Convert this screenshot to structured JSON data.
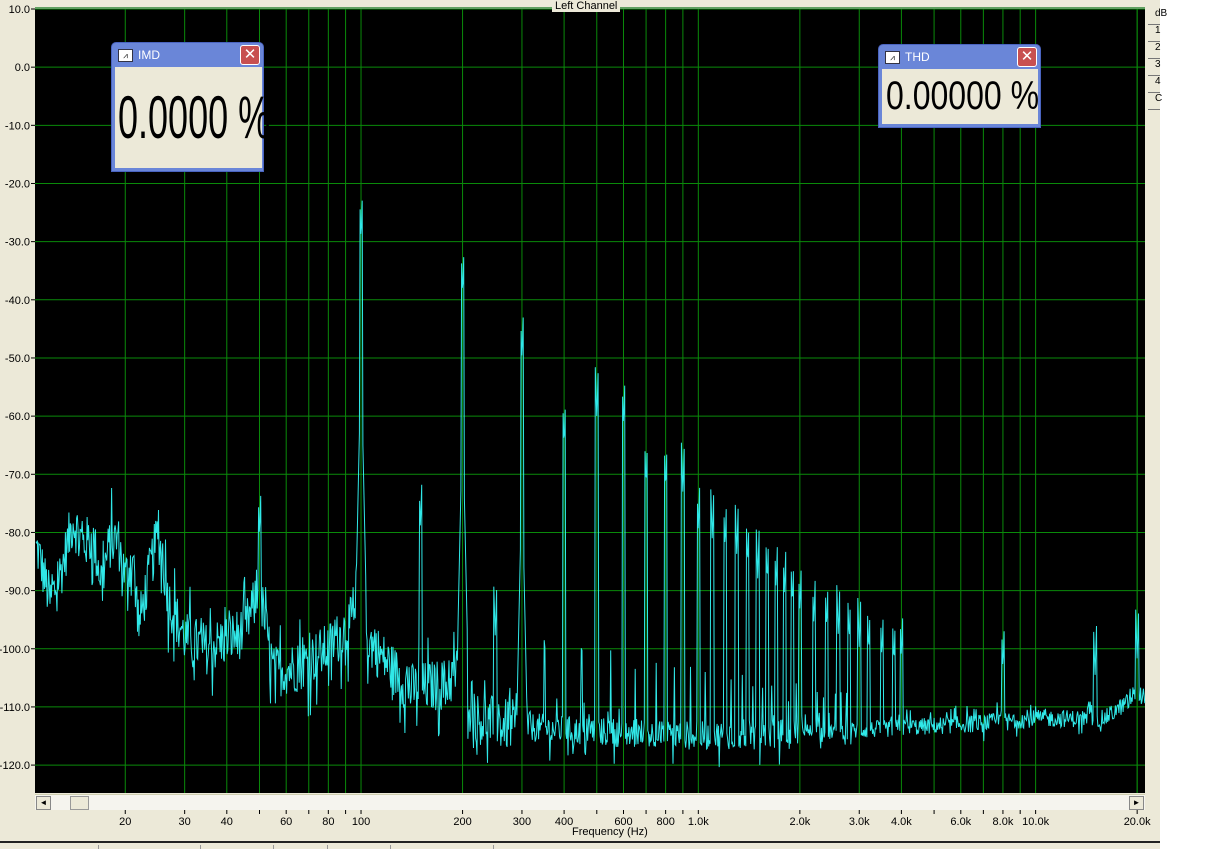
{
  "window": {
    "title": "Left Channel"
  },
  "side_buttons": [
    "dB",
    "1",
    "2",
    "3",
    "4",
    "C"
  ],
  "imd": {
    "title": "IMD",
    "value": "0.0000 %"
  },
  "thd": {
    "title": "THD",
    "value": "0.00000 %"
  },
  "scroll": {
    "left": "◄",
    "right": "►"
  },
  "chart_data": {
    "type": "line",
    "title": "Left Channel",
    "xlabel": "Frequency (Hz)",
    "ylabel": "dB",
    "xscale": "log",
    "xlim": [
      10.8,
      21100
    ],
    "ylim": [
      -124.8,
      10
    ],
    "grid": true,
    "yticks": [
      10,
      0,
      -10,
      -20,
      -30,
      -40,
      -50,
      -60,
      -70,
      -80,
      -90,
      -100,
      -110,
      -120
    ],
    "ytick_labels": [
      "10.0",
      "0.0",
      "-10.0",
      "-20.0",
      "-30.0",
      "-40.0",
      "-50.0",
      "-60.0",
      "-70.0",
      "-80.0",
      "-90.0",
      "-100.0",
      "-110.0",
      "-120.0"
    ],
    "xticks": [
      20,
      30,
      40,
      60,
      80,
      100,
      200,
      300,
      400,
      600,
      800,
      1000,
      2000,
      3000,
      4000,
      6000,
      8000,
      10000,
      20000
    ],
    "xtick_labels": [
      "20",
      "30",
      "40",
      "60",
      "80",
      "100",
      "200",
      "300",
      "400",
      "600",
      "800",
      "1.0k",
      "2.0k",
      "3.0k",
      "4.0k",
      "6.0k",
      "8.0k",
      "10.0k",
      "20.0k"
    ],
    "series": [
      {
        "name": "Left Channel spectrum",
        "color": "#30e8e8",
        "noise_floor": [
          [
            11,
            -83
          ],
          [
            12,
            -92
          ],
          [
            13,
            -86
          ],
          [
            14,
            -78
          ],
          [
            15,
            -82
          ],
          [
            16,
            -81
          ],
          [
            17,
            -88
          ],
          [
            18,
            -82
          ],
          [
            19,
            -81
          ],
          [
            20,
            -88
          ],
          [
            21,
            -84
          ],
          [
            22,
            -96
          ],
          [
            23,
            -90
          ],
          [
            25,
            -80
          ],
          [
            27,
            -92
          ],
          [
            30,
            -98
          ],
          [
            35,
            -100
          ],
          [
            45,
            -97
          ],
          [
            50,
            -90
          ],
          [
            55,
            -104
          ],
          [
            65,
            -103
          ],
          [
            80,
            -100
          ],
          [
            95,
            -95
          ],
          [
            110,
            -100
          ],
          [
            140,
            -107
          ],
          [
            180,
            -106
          ],
          [
            200,
            -103
          ],
          [
            220,
            -112
          ],
          [
            260,
            -113
          ],
          [
            400,
            -114
          ],
          [
            1000,
            -115
          ],
          [
            3000,
            -114
          ],
          [
            6000,
            -113
          ],
          [
            10000,
            -112
          ],
          [
            16000,
            -112
          ],
          [
            20000,
            -108
          ]
        ],
        "peaks": [
          [
            50,
            -81
          ],
          [
            100,
            -30
          ],
          [
            150,
            -79.5
          ],
          [
            200,
            -39.5
          ],
          [
            250,
            -98
          ],
          [
            300,
            -50.5
          ],
          [
            400,
            -65.5
          ],
          [
            500,
            -60.5
          ],
          [
            600,
            -62
          ],
          [
            700,
            -72.5
          ],
          [
            800,
            -73
          ],
          [
            900,
            -73.5
          ],
          [
            1000,
            -80
          ],
          [
            1100,
            -81.5
          ],
          [
            1200,
            -83
          ],
          [
            1300,
            -84
          ],
          [
            1400,
            -86
          ],
          [
            1500,
            -88
          ],
          [
            1600,
            -89
          ],
          [
            1700,
            -90
          ],
          [
            1800,
            -91
          ],
          [
            1900,
            -93
          ],
          [
            2000,
            -94
          ],
          [
            2200,
            -96
          ],
          [
            2400,
            -97
          ],
          [
            2600,
            -98
          ],
          [
            2800,
            -99
          ],
          [
            3000,
            -100
          ],
          [
            3200,
            -101
          ],
          [
            3500,
            -102
          ],
          [
            3800,
            -103
          ],
          [
            4000,
            -102
          ],
          [
            8000,
            -104
          ],
          [
            15000,
            -105
          ],
          [
            20000,
            -102
          ]
        ]
      }
    ]
  }
}
